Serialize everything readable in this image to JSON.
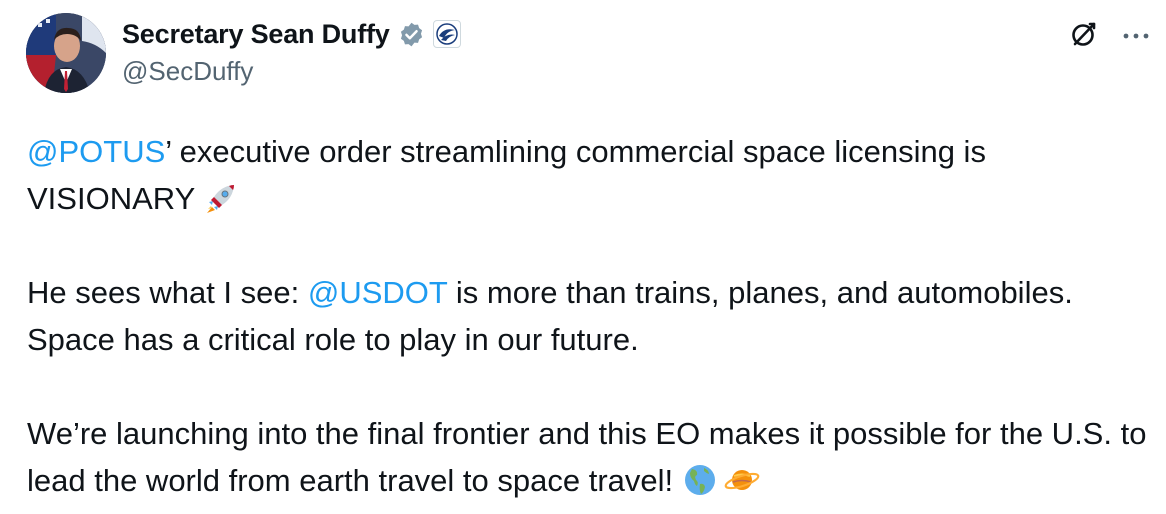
{
  "author": {
    "display_name": "Secretary Sean Duffy",
    "handle": "@SecDuffy",
    "verified_badge": "verified-badge-icon",
    "affiliation_badge": "usdot-affiliation-icon"
  },
  "actions": {
    "grok_icon": "grok-icon",
    "more_label": "···"
  },
  "tweet": {
    "p1": {
      "mention": "@POTUS",
      "text": "’ executive order streamlining commercial space licensing is VISIONARY",
      "emoji": "rocket-emoji"
    },
    "p2": {
      "lead": "He sees what I see: ",
      "mention": "@USDOT",
      "text": " is more than trains, planes, and automobiles. Space has a critical role to play in our future."
    },
    "p3": {
      "text": "We’re launching into the final frontier and this EO makes it possible for the U.S. to lead the world from earth travel to space travel!",
      "emoji1": "globe-americas-emoji",
      "emoji2": "ringed-planet-emoji"
    }
  },
  "colors": {
    "text": "#0f1419",
    "secondary": "#536471",
    "link": "#1d9bf0",
    "badge": "#829aab"
  }
}
